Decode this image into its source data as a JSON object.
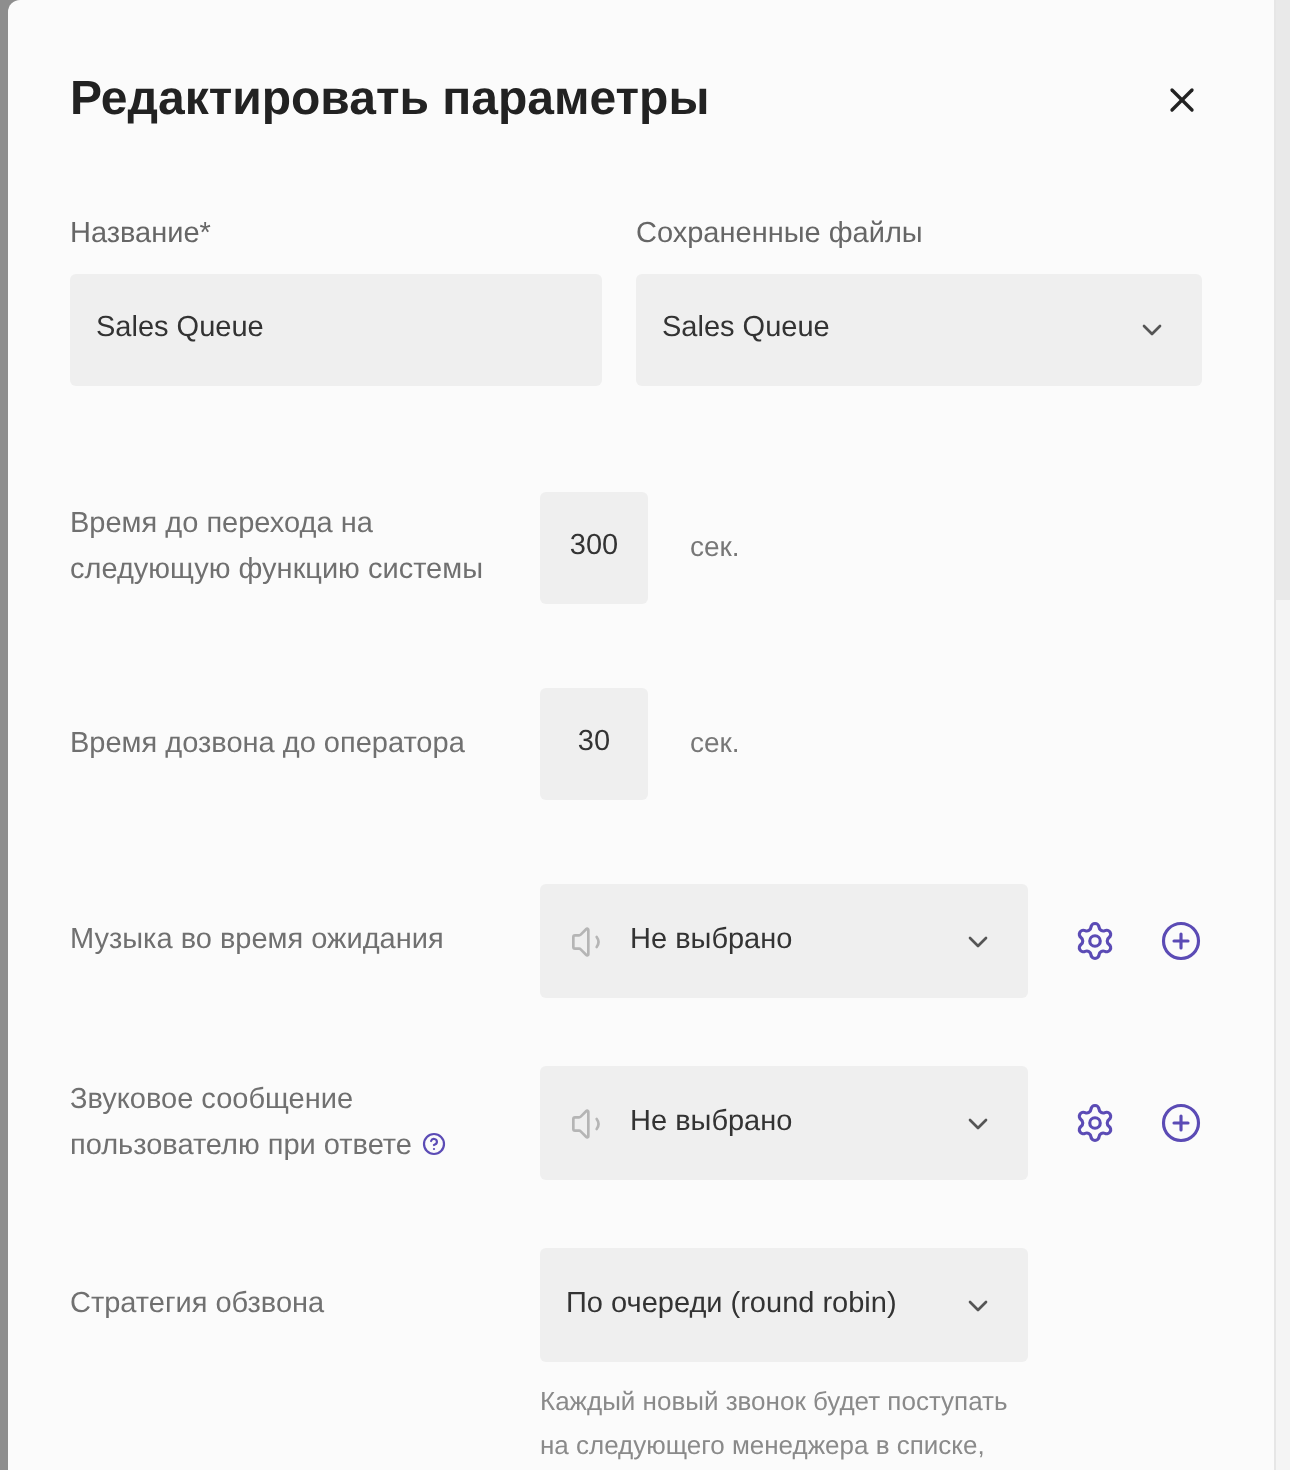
{
  "dialog": {
    "title": "Редактировать параметры"
  },
  "name_field": {
    "label": "Название*",
    "value": "Sales Queue"
  },
  "saved_files": {
    "label": "Сохраненные файлы",
    "value": "Sales Queue"
  },
  "settings": [
    {
      "kind": "number",
      "label": "Время до перехода на следующую функцию системы",
      "value": "300",
      "unit": "сек."
    },
    {
      "kind": "number",
      "label": "Время дозвона до оператора",
      "value": "30",
      "unit": "сек."
    },
    {
      "kind": "audio",
      "label": "Музыка во время ожидания",
      "help": false,
      "value": "Не выбрано"
    },
    {
      "kind": "audio",
      "label": "Звуковое сообщение пользователю при ответе",
      "help": true,
      "value": "Не выбрано"
    },
    {
      "kind": "select",
      "label": "Стратегия обзвона",
      "value": "По очереди (round robin)",
      "hint_lines": [
        "Каждый новый звонок будет поступать",
        "на следующего менеджера в списке,"
      ]
    }
  ]
}
